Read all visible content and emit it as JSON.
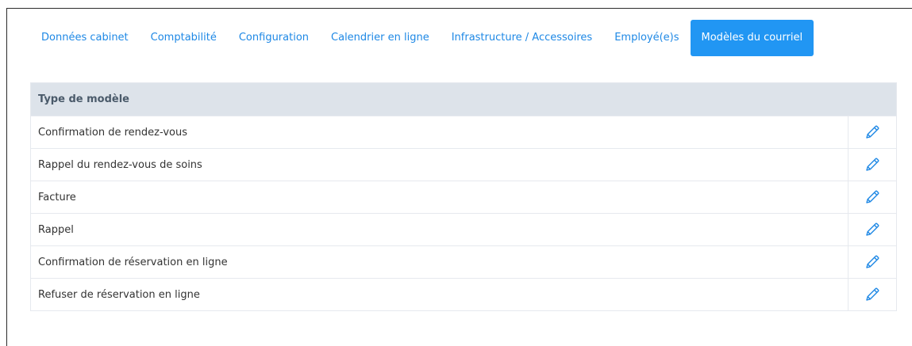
{
  "tabs": [
    {
      "label": "Données cabinet",
      "active": false
    },
    {
      "label": "Comptabilité",
      "active": false
    },
    {
      "label": "Configuration",
      "active": false
    },
    {
      "label": "Calendrier en ligne",
      "active": false
    },
    {
      "label": "Infrastructure / Accessoires",
      "active": false
    },
    {
      "label": "Employé(e)s",
      "active": false
    },
    {
      "label": "Modèles du courriel",
      "active": true
    }
  ],
  "table": {
    "header": "Type de modèle",
    "rows": [
      {
        "name": "Confirmation de rendez-vous",
        "action_icon": "pencil-icon"
      },
      {
        "name": "Rappel du rendez-vous de soins",
        "action_icon": "pencil-icon"
      },
      {
        "name": "Facture",
        "action_icon": "pencil-icon"
      },
      {
        "name": "Rappel",
        "action_icon": "pencil-icon"
      },
      {
        "name": "Confirmation de réservation en ligne",
        "action_icon": "pencil-icon"
      },
      {
        "name": "Refuser de réservation en ligne",
        "action_icon": "pencil-icon"
      }
    ]
  },
  "colors": {
    "accent": "#2196f3",
    "link": "#1e88e5",
    "header_bg": "#dde3ea"
  }
}
